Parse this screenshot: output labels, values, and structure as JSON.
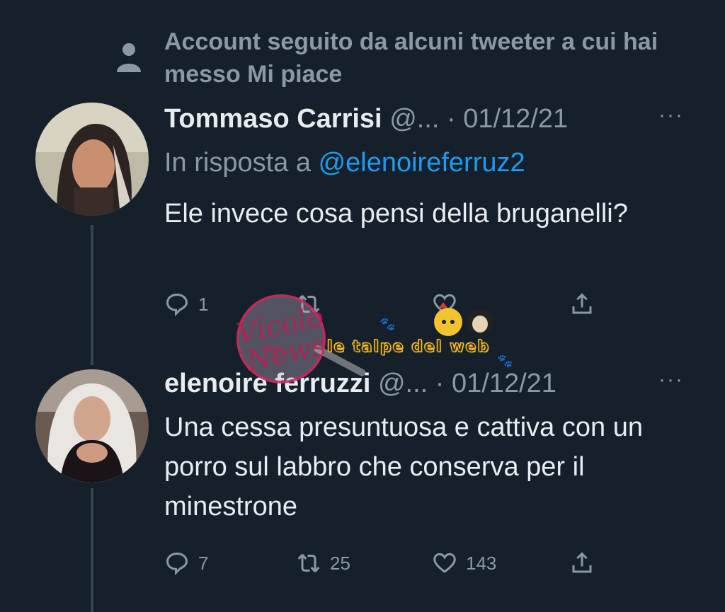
{
  "context": {
    "text": "Account seguito da alcuni tweeter a cui hai messo Mi piace",
    "icon": "person-icon"
  },
  "tweets": [
    {
      "name": "Tommaso Carrisi",
      "handle": "@...",
      "separator": "·",
      "date": "01/12/21",
      "reply_prefix": "In risposta a",
      "reply_handle": "@elenoireferruz2",
      "text": "Ele invece cosa pensi della bruganelli?",
      "replies": "1",
      "retweets": "",
      "likes": ""
    },
    {
      "name": "elenoire ferruzzi",
      "handle": "@...",
      "separator": "·",
      "date": "01/12/21",
      "text": "Una cessa presuntuosa e cattiva con un porro sul labbro che conserva per il minestrone",
      "replies": "7",
      "retweets": "25",
      "likes": "143"
    }
  ],
  "more_label": "···",
  "watermarks": {
    "vicolo_main": "Vicolo",
    "vicolo_small": "delle",
    "vicolo_tail": "News",
    "talpe": "le talpe del web"
  },
  "colors": {
    "background": "#15202b",
    "link": "#1d9bf0",
    "muted": "#8b98a5",
    "text": "#e8ecef"
  }
}
